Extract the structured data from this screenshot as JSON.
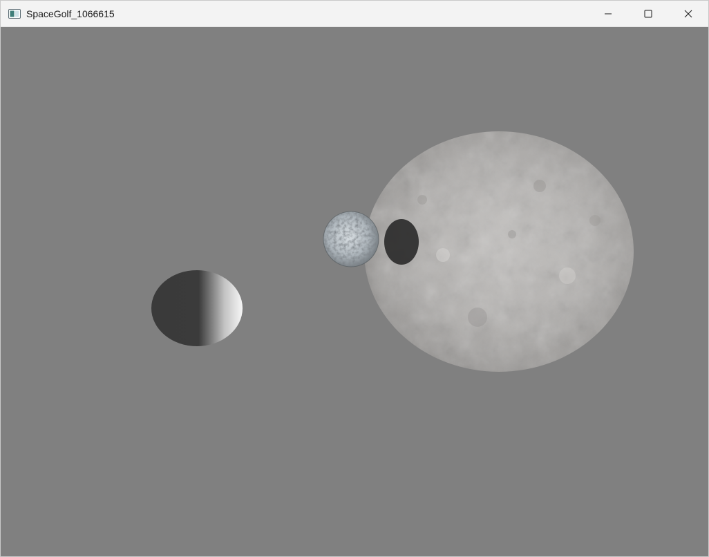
{
  "window": {
    "title": "SpaceGolf_1066615",
    "icon": "app-window-icon",
    "controls": [
      {
        "name": "minimize-icon"
      },
      {
        "name": "maximize-icon"
      },
      {
        "name": "close-icon"
      }
    ]
  },
  "scene": {
    "background_color": "#808080",
    "objects": [
      {
        "name": "golf-ball",
        "texture": "smooth-shaded-white"
      },
      {
        "name": "small-moon",
        "texture": "icy-cratered"
      },
      {
        "name": "large-moon",
        "texture": "gray-cratered"
      },
      {
        "name": "moon-shadow",
        "texture": "dark"
      }
    ]
  }
}
